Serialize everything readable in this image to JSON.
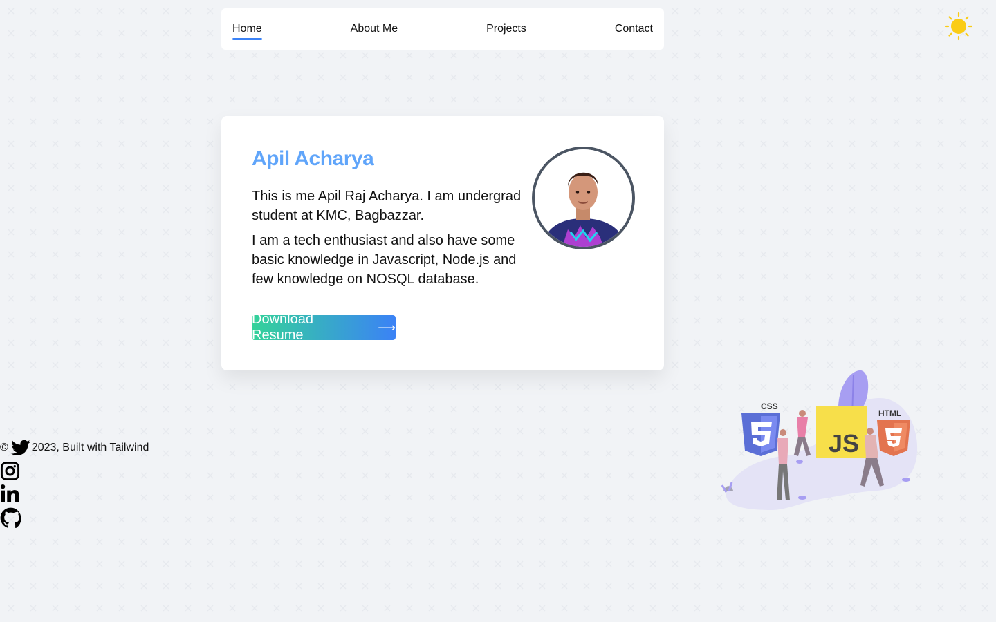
{
  "nav": {
    "items": [
      {
        "label": "Home",
        "active": true
      },
      {
        "label": "About Me",
        "active": false
      },
      {
        "label": "Projects",
        "active": false
      },
      {
        "label": "Contact",
        "active": false
      }
    ]
  },
  "theme_toggle": {
    "icon": "sun-icon",
    "color": "#facc15"
  },
  "profile": {
    "name": "Apil Acharya",
    "bio_1": "This is me Apil Raj Acharya. I am undergrad student at KMC, Bagbazzar.",
    "bio_2": "I am a tech enthusiast and also have some basic knowledge in Javascript, Node.js and few knowledge on NOSQL database.",
    "download_label": "Download Resume",
    "download_icon": "arrow-right-icon"
  },
  "footer": {
    "copyright_symbol": "©",
    "text": "2023, Built with Tailwind",
    "social_icons": [
      "twitter-icon",
      "instagram-icon",
      "linkedin-icon",
      "github-icon"
    ]
  },
  "illustration": {
    "labels": {
      "css": "CSS",
      "js": "JS",
      "html": "HTML"
    }
  },
  "colors": {
    "accent": "#3b82f6",
    "name": "#60a5fa",
    "gradient_start": "#34d399",
    "gradient_end": "#3b82f6",
    "background": "#f1f3f6"
  }
}
